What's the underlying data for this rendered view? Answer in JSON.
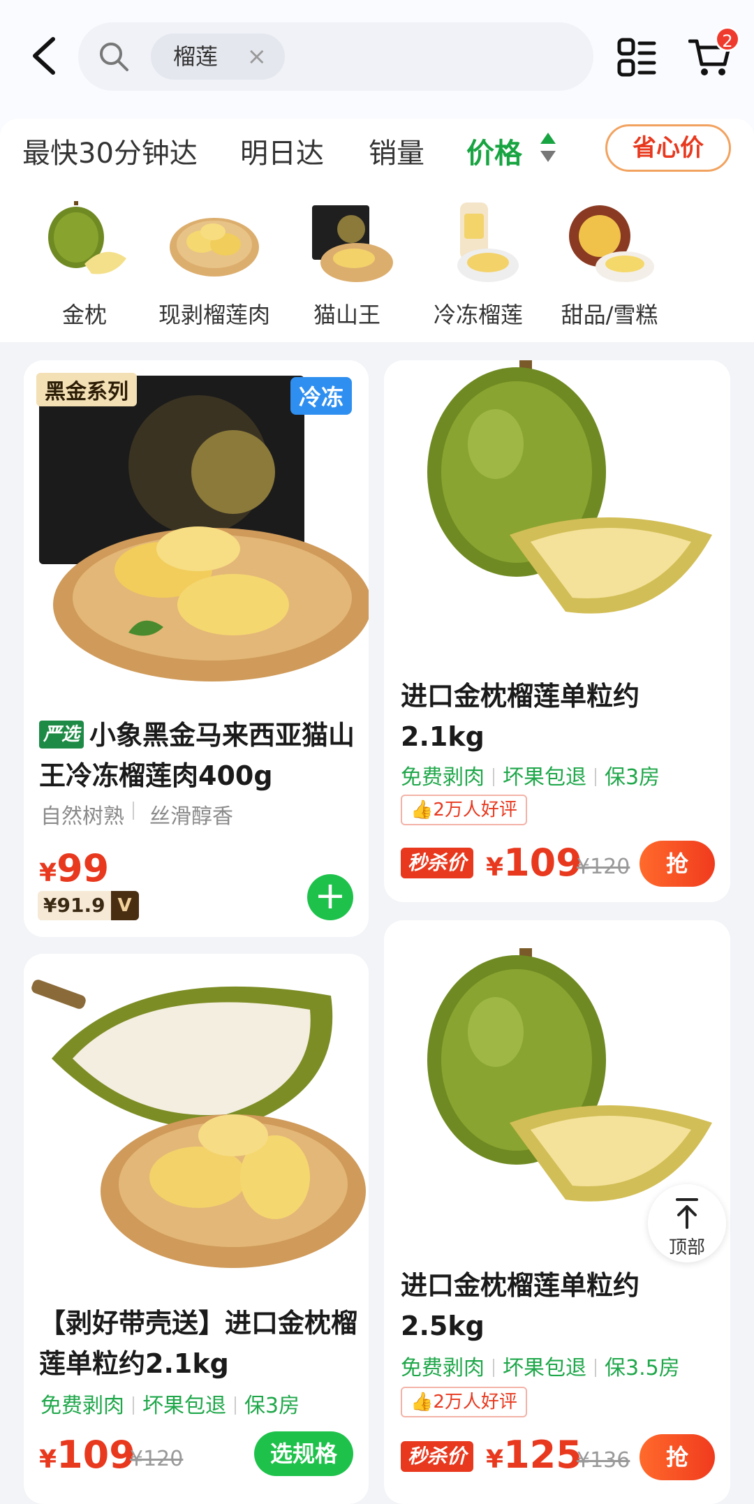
{
  "header": {
    "search_chip": "榴莲",
    "chip_close": "×",
    "cart_count": "2"
  },
  "filters": {
    "fastest": "最快30分钟达",
    "tomorrow": "明日达",
    "sales": "销量",
    "price": "价格",
    "save_price": "省心价"
  },
  "categories": [
    {
      "label": "金枕",
      "icon": "durian-whole-icon"
    },
    {
      "label": "现剥榴莲肉",
      "icon": "durian-flesh-plate-icon"
    },
    {
      "label": "猫山王",
      "icon": "musang-king-box-icon"
    },
    {
      "label": "冷冻榴莲",
      "icon": "frozen-durian-icon"
    },
    {
      "label": "甜品/雪糕",
      "icon": "dessert-icon"
    }
  ],
  "products": [
    {
      "badge_tl": "黑金系列",
      "badge_tr": "冷冻",
      "selection_tag": "严选",
      "title": "小象黑金马来西亚猫山王冷冻榴莲肉400g",
      "subtitle_a": "自然树熟",
      "subtitle_b": "丝滑醇香",
      "currency": "¥",
      "price": "99",
      "vip_price": "¥91.9",
      "vip_mark": "V",
      "add_label": "+"
    },
    {
      "title": "进口金枕榴莲单粒约2.1kg",
      "tags": [
        "免费剥肉",
        "坏果包退",
        "保3房"
      ],
      "review": "2万人好评",
      "seckill": "秒杀价",
      "currency": "¥",
      "price": "109",
      "old_price": "¥120",
      "grab": "抢"
    },
    {
      "title": "【剥好带壳送】进口金枕榴莲单粒约2.1kg",
      "tags": [
        "免费剥肉",
        "坏果包退",
        "保3房"
      ],
      "currency": "¥",
      "price": "109",
      "old_price": "¥120",
      "spec": "选规格"
    },
    {
      "title": "进口金枕榴莲单粒约2.5kg",
      "tags": [
        "免费剥肉",
        "坏果包退",
        "保3.5房"
      ],
      "review": "2万人好评",
      "seckill": "秒杀价",
      "currency": "¥",
      "price": "125",
      "old_price": "¥136",
      "grab": "抢"
    }
  ],
  "to_top": "顶部",
  "colors": {
    "brand_green": "#1ec24b",
    "price_red": "#e8381e",
    "price_green": "#17a441"
  }
}
